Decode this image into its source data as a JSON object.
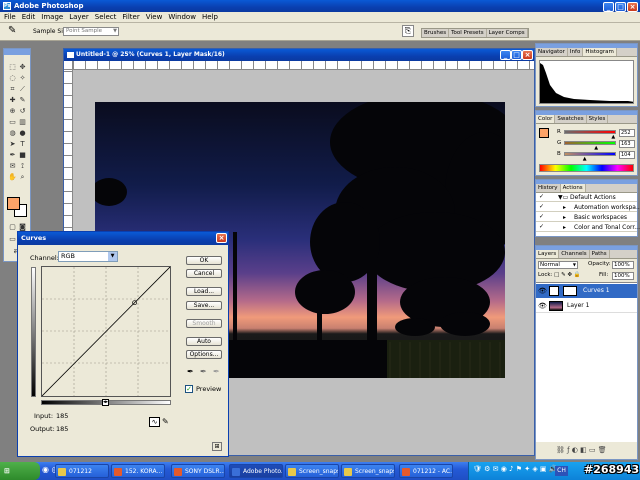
{
  "app": {
    "title": "Adobe Photoshop",
    "controls": [
      "_",
      "□",
      "×"
    ]
  },
  "menu": [
    "File",
    "Edit",
    "Image",
    "Layer",
    "Select",
    "Filter",
    "View",
    "Window",
    "Help"
  ],
  "options_bar": {
    "sample_size_label": "Sample Size:",
    "sample_size_value": "Point Sample",
    "tabs": [
      "Brushes",
      "Tool Presets",
      "Layer Comps"
    ]
  },
  "document": {
    "title": "Untitled-1 @ 25% (Curves 1, Layer Mask/16)"
  },
  "navigator": {
    "tabs": [
      "Navigator",
      "Info",
      "Histogram"
    ]
  },
  "color_panel": {
    "tabs": [
      "Color",
      "Swatches",
      "Styles"
    ],
    "channels": [
      {
        "label": "R",
        "value": "252"
      },
      {
        "label": "G",
        "value": "163"
      },
      {
        "label": "B",
        "value": "104"
      }
    ],
    "slider_positions": [
      0.95,
      0.62,
      0.4
    ],
    "swatch_color": "#fca368"
  },
  "actions_panel": {
    "tabs": [
      "History",
      "Actions"
    ],
    "items": [
      "Default Actions",
      "Automation workspa...",
      "Basic workspaces",
      "Color and Tonal Corr..."
    ]
  },
  "layers_panel": {
    "tabs": [
      "Layers",
      "Channels",
      "Paths"
    ],
    "blend_mode": "Normal",
    "opacity_label": "Opacity:",
    "opacity_value": "100%",
    "fill_label": "Fill:",
    "fill_value": "100%",
    "layers": [
      {
        "name": "Curves 1",
        "selected": true
      },
      {
        "name": "Layer 1",
        "selected": false
      }
    ]
  },
  "curves": {
    "title": "Curves",
    "channel_label": "Channel:",
    "channel_value": "RGB",
    "buttons": {
      "ok": "OK",
      "cancel": "Cancel",
      "load": "Load...",
      "save": "Save...",
      "smooth": "Smooth",
      "auto": "Auto",
      "options": "Options..."
    },
    "preview_label": "Preview",
    "preview_checked": true,
    "input_label": "Input:",
    "input_value": "185",
    "output_label": "Output:",
    "output_value": "185"
  },
  "taskbar": {
    "tasks": [
      {
        "label": "071212",
        "color": "#e8c84a"
      },
      {
        "label": "152. KORA...",
        "color": "#e55a2b"
      },
      {
        "label": "SONY DSLR...",
        "color": "#e55a2b"
      },
      {
        "label": "Adobe Photo...",
        "color": "#3a6fd8",
        "active": true
      },
      {
        "label": "Screen_snaps...",
        "color": "#e8c84a"
      },
      {
        "label": "Screen_snaps...",
        "color": "#e8c84a"
      },
      {
        "label": "071212 - AC...",
        "color": "#e55a2b"
      }
    ],
    "lang": "CH",
    "watermark": "#268943"
  }
}
